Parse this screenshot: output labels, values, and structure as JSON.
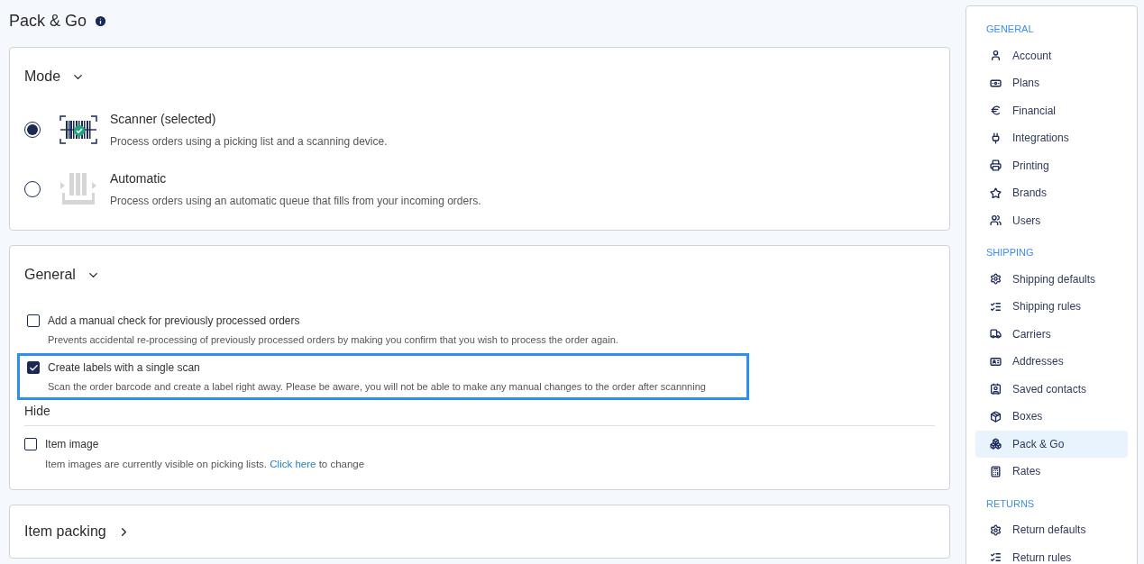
{
  "page": {
    "title": "Pack & Go"
  },
  "mode": {
    "title": "Mode",
    "expanded": true,
    "options": [
      {
        "title": "Scanner (selected)",
        "description": "Process orders using a picking list and a scanning device.",
        "selected": true
      },
      {
        "title": "Automatic",
        "description": "Process orders using an automatic queue that fills from your incoming orders.",
        "selected": false
      }
    ]
  },
  "general": {
    "title": "General",
    "expanded": true,
    "settings": [
      {
        "label": "Add a manual check for previously processed orders",
        "description": "Prevents accidental re-processing of previously processed orders by making you confirm that you wish to process the order again.",
        "checked": false,
        "highlighted": false
      },
      {
        "label": "Create labels with a single scan",
        "description": "Scan the order barcode and create a label right away. Please be aware, you will not be able to make any manual changes to the order after scannning",
        "checked": true,
        "highlighted": true
      }
    ],
    "hide_heading": "Hide",
    "hide_settings": [
      {
        "label": "Item image",
        "description": "Item images are currently visible on picking lists.",
        "link": "Click here",
        "description_end": "to change",
        "checked": false
      }
    ]
  },
  "item_packing": {
    "title": "Item packing",
    "expanded": false
  },
  "sidebar": {
    "sections": [
      {
        "heading": "GENERAL",
        "items": [
          {
            "label": "Account",
            "selected": false
          },
          {
            "label": "Plans",
            "selected": false
          },
          {
            "label": "Financial",
            "selected": false
          },
          {
            "label": "Integrations",
            "selected": false
          },
          {
            "label": "Printing",
            "selected": false
          },
          {
            "label": "Brands",
            "selected": false
          },
          {
            "label": "Users",
            "selected": false
          }
        ]
      },
      {
        "heading": "SHIPPING",
        "items": [
          {
            "label": "Shipping defaults",
            "selected": false
          },
          {
            "label": "Shipping rules",
            "selected": false
          },
          {
            "label": "Carriers",
            "selected": false
          },
          {
            "label": "Addresses",
            "selected": false
          },
          {
            "label": "Saved contacts",
            "selected": false
          },
          {
            "label": "Boxes",
            "selected": false
          },
          {
            "label": "Pack & Go",
            "selected": true
          },
          {
            "label": "Rates",
            "selected": false
          }
        ]
      },
      {
        "heading": "RETURNS",
        "items": [
          {
            "label": "Return defaults",
            "selected": false
          },
          {
            "label": "Return rules",
            "selected": false
          }
        ]
      }
    ]
  }
}
